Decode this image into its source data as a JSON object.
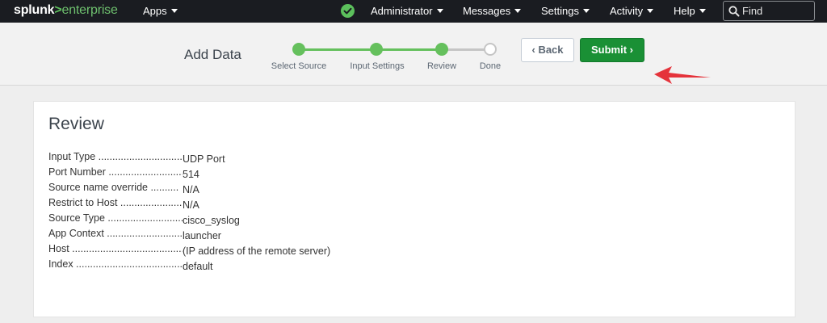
{
  "nav": {
    "logo_prefix": "splunk",
    "logo_gt": ">",
    "logo_suffix": "enterprise",
    "apps": "Apps",
    "administrator": "Administrator",
    "messages": "Messages",
    "settings": "Settings",
    "activity": "Activity",
    "help": "Help",
    "find": "Find"
  },
  "header": {
    "title": "Add Data",
    "steps": [
      {
        "label": "Select Source",
        "state": "complete"
      },
      {
        "label": "Input Settings",
        "state": "complete"
      },
      {
        "label": "Review",
        "state": "complete"
      },
      {
        "label": "Done",
        "state": "pending"
      }
    ],
    "back_label": "Back",
    "submit_label": "Submit"
  },
  "review": {
    "title": "Review",
    "rows": [
      {
        "key": "Input Type ................................",
        "value": "UDP Port"
      },
      {
        "key": "Port Number ...........................",
        "value": "514"
      },
      {
        "key": "Source name override ..........",
        "value": "N/A"
      },
      {
        "key": "Restrict to Host .......................",
        "value": "N/A"
      },
      {
        "key": "Source Type ............................",
        "value": "cisco_syslog"
      },
      {
        "key": "App Context ...........................",
        "value": "launcher"
      },
      {
        "key": "Host ..........................................",
        "value": "(IP address of the remote server)"
      },
      {
        "key": "Index .........................................",
        "value": "default"
      }
    ]
  },
  "colors": {
    "nav_bg": "#1a1c21",
    "accent_green": "#65c05d",
    "submit_green": "#1a9035",
    "annotation_arrow": "#e5333b"
  }
}
